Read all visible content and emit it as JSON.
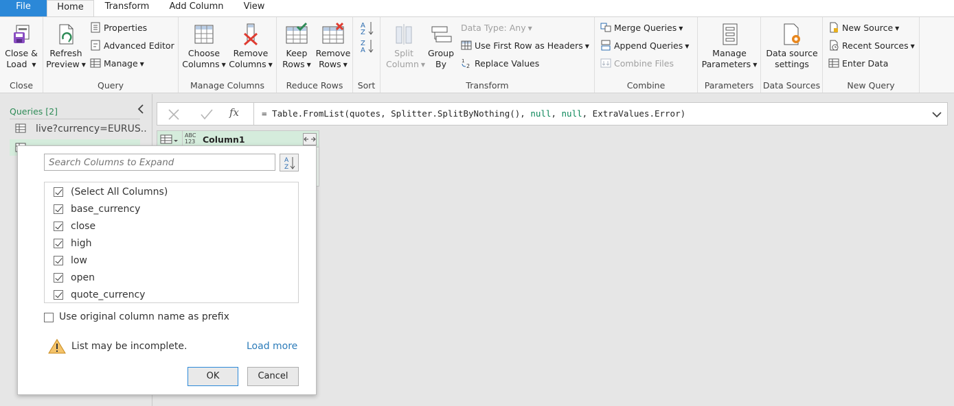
{
  "tabs": [
    "File",
    "Home",
    "Transform",
    "Add Column",
    "View"
  ],
  "ribbon": {
    "close_group": {
      "label": "Close",
      "close_load": [
        "Close &",
        "Load"
      ]
    },
    "query_group": {
      "label": "Query",
      "refresh": [
        "Refresh",
        "Preview"
      ],
      "properties": "Properties",
      "advanced_editor": "Advanced Editor",
      "manage": "Manage"
    },
    "manage_columns_group": {
      "label": "Manage Columns",
      "choose": [
        "Choose",
        "Columns"
      ],
      "remove": [
        "Remove",
        "Columns"
      ]
    },
    "reduce_rows_group": {
      "label": "Reduce Rows",
      "keep": [
        "Keep",
        "Rows"
      ],
      "remove": [
        "Remove",
        "Rows"
      ]
    },
    "sort_group": {
      "label": "Sort"
    },
    "transform_group": {
      "label": "Transform",
      "split": [
        "Split",
        "Column"
      ],
      "group_by": [
        "Group",
        "By"
      ],
      "data_type": "Data Type: Any",
      "first_row": "Use First Row as Headers",
      "replace": "Replace Values"
    },
    "combine_group": {
      "label": "Combine",
      "merge": "Merge Queries",
      "append": "Append Queries",
      "combine_files": "Combine Files"
    },
    "parameters_group": {
      "label": "Parameters",
      "manage": [
        "Manage",
        "Parameters"
      ]
    },
    "data_sources_group": {
      "label": "Data Sources",
      "settings": [
        "Data source",
        "settings"
      ]
    },
    "new_query_group": {
      "label": "New Query",
      "new_source": "New Source",
      "recent_sources": "Recent Sources",
      "enter_data": "Enter Data"
    }
  },
  "queries": {
    "header": "Queries [2]",
    "items": [
      "live?currency=EURUS..."
    ]
  },
  "formula": {
    "prefix": "= Table.FromList(quotes, Splitter.SplitByNothing(), ",
    "null1": "null",
    "sep1": ", ",
    "null2": "null",
    "suffix": ", ExtraValues.Error)"
  },
  "grid": {
    "type_top": "ABC",
    "type_bottom": "123",
    "column_name": "Column1"
  },
  "expand_popup": {
    "search_placeholder": "Search Columns to Expand",
    "columns": [
      {
        "label": "(Select All Columns)",
        "checked": true
      },
      {
        "label": "base_currency",
        "checked": true
      },
      {
        "label": "close",
        "checked": true
      },
      {
        "label": "high",
        "checked": true
      },
      {
        "label": "low",
        "checked": true
      },
      {
        "label": "open",
        "checked": true
      },
      {
        "label": "quote_currency",
        "checked": true
      }
    ],
    "prefix_option": "Use original column name as prefix",
    "warning": "List may be incomplete.",
    "load_more": "Load more",
    "ok": "OK",
    "cancel": "Cancel"
  },
  "colors": {
    "file_tab": "#2b88d8",
    "accent_green": "#d5ecdc",
    "link": "#2b7bb9"
  }
}
